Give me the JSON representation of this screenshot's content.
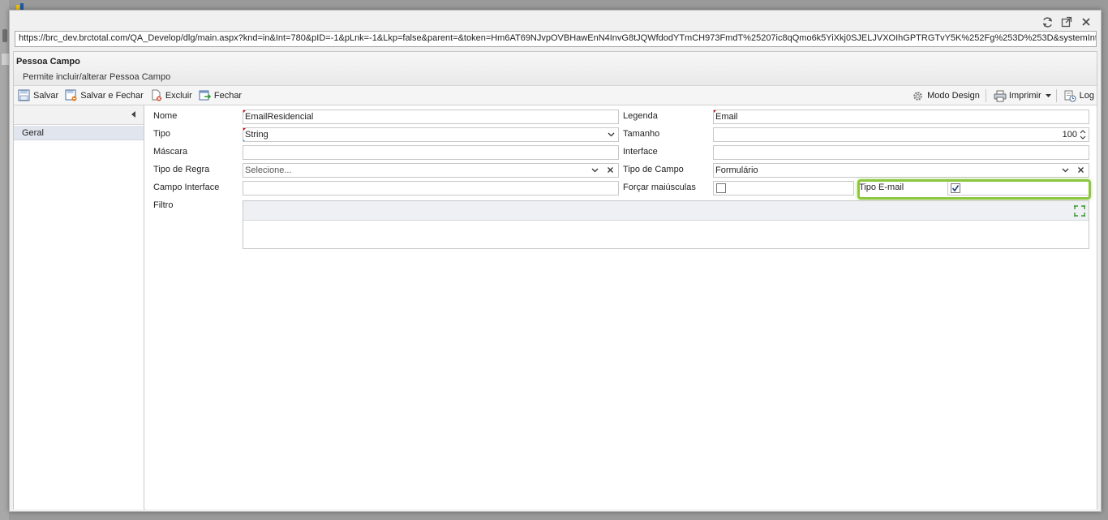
{
  "window": {
    "url": "https://brc_dev.brctotal.com/QA_Develop/dlg/main.aspx?knd=in&Int=780&pID=-1&pLnk=-1&Lkp=false&parent=&token=Hm6AT69NJvpOVBHawEnN4InvG8tJQWfdodYTmCH973FmdT%25207ic8qQmo6k5YiXkj0SJELJVXOIhGPTRGTvY5K%252Fg%253D%253D&systemInterfa"
  },
  "header": {
    "title": "Pessoa Campo",
    "subtitle": "Permite incluir/alterar Pessoa Campo"
  },
  "toolbar": {
    "save_label": "Salvar",
    "save_close_label": "Salvar e Fechar",
    "delete_label": "Excluir",
    "close_label": "Fechar",
    "design_label": "Modo Design",
    "print_label": "Imprimir",
    "log_label": "Log"
  },
  "nav": {
    "items": [
      {
        "label": "Geral"
      }
    ]
  },
  "form": {
    "nome": {
      "label": "Nome",
      "value": "EmailResidencial"
    },
    "legenda": {
      "label": "Legenda",
      "value": "Email"
    },
    "tipo": {
      "label": "Tipo",
      "value": "String"
    },
    "tamanho": {
      "label": "Tamanho",
      "value": "100"
    },
    "mascara": {
      "label": "Máscara",
      "value": ""
    },
    "interface": {
      "label": "Interface",
      "value": ""
    },
    "tipo_regra": {
      "label": "Tipo de Regra",
      "placeholder": "Selecione..."
    },
    "tipo_campo": {
      "label": "Tipo de Campo",
      "value": "Formulário"
    },
    "campo_interface": {
      "label": "Campo Interface",
      "value": ""
    },
    "forcar_maiusculas": {
      "label": "Forçar maiúsculas",
      "checked": false
    },
    "tipo_email": {
      "label": "Tipo E-mail",
      "checked": true
    },
    "filtro": {
      "label": "Filtro",
      "value": ""
    }
  },
  "colors": {
    "highlight": "#8cc63f",
    "required_marker": "#d00000",
    "nav_selected": "#e1e6ee"
  },
  "icons": [
    "refresh-icon",
    "popout-icon",
    "close-icon",
    "save-icon",
    "save-close-icon",
    "delete-icon",
    "exit-icon",
    "gear-icon",
    "printer-icon",
    "log-icon",
    "expand-icon"
  ]
}
